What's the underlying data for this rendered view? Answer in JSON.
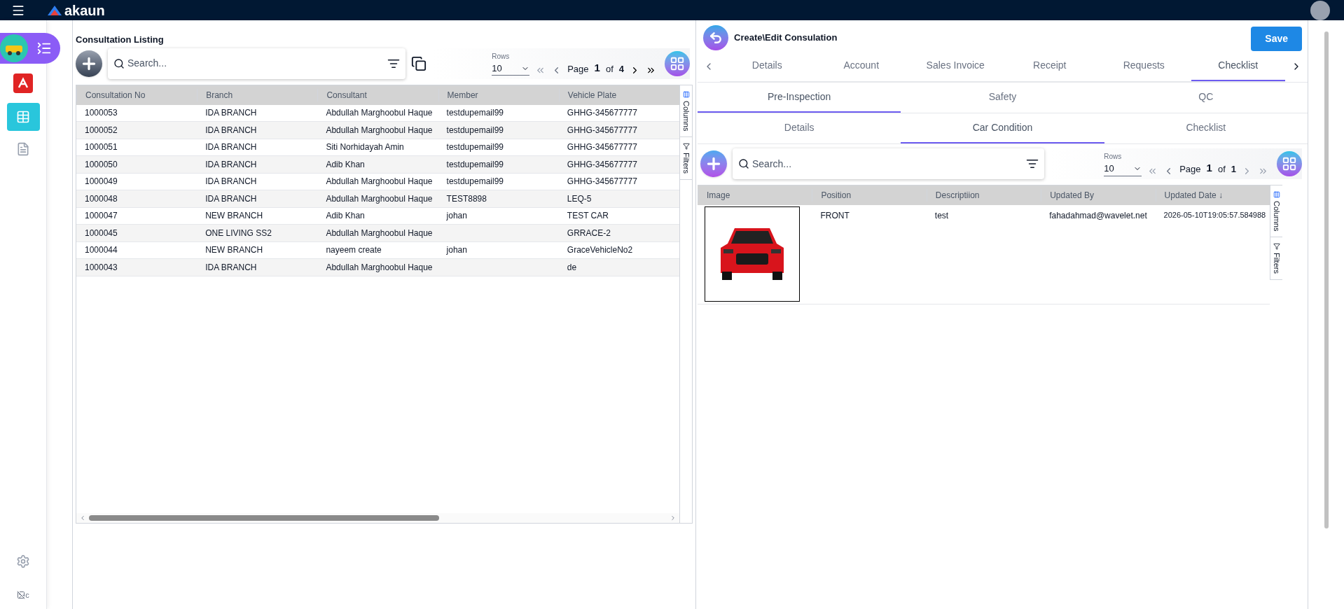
{
  "header": {
    "logo": "akaun"
  },
  "sidebar": {
    "items": [
      {
        "kind": "app",
        "selected": false
      },
      {
        "kind": "pdf",
        "selected": false
      },
      {
        "kind": "table",
        "selected": true
      },
      {
        "kind": "invoice",
        "selected": false
      }
    ],
    "broken_image_alt": "c"
  },
  "listing": {
    "title": "Consultation Listing",
    "search": {
      "placeholder": "Search..."
    },
    "pager": {
      "rows_label": "Rows",
      "rows": "10",
      "page_word": "Page",
      "page": "1",
      "of_word": "of",
      "total": "4"
    },
    "columns": [
      "Consultation No",
      "Branch",
      "Consultant",
      "Member",
      "Vehicle Plate"
    ],
    "rows": [
      [
        "1000053",
        "IDA BRANCH",
        "Abdullah Marghoobul Haque",
        "testdupemail99",
        "GHHG-345677777"
      ],
      [
        "1000052",
        "IDA BRANCH",
        "Abdullah Marghoobul Haque",
        "testdupemail99",
        "GHHG-345677777"
      ],
      [
        "1000051",
        "IDA BRANCH",
        "Siti Norhidayah Amin",
        "testdupemail99",
        "GHHG-345677777"
      ],
      [
        "1000050",
        "IDA BRANCH",
        "Adib Khan",
        "testdupemail99",
        "GHHG-345677777"
      ],
      [
        "1000049",
        "IDA BRANCH",
        "Abdullah Marghoobul Haque",
        "testdupemail99",
        "GHHG-345677777"
      ],
      [
        "1000048",
        "IDA BRANCH",
        "Abdullah Marghoobul Haque",
        "TEST8898",
        "LEQ-5"
      ],
      [
        "1000047",
        "NEW BRANCH",
        "Adib Khan",
        "johan",
        "TEST CAR"
      ],
      [
        "1000045",
        "ONE LIVING SS2",
        "Abdullah Marghoobul Haque",
        "",
        "GRRACE-2"
      ],
      [
        "1000044",
        "NEW BRANCH",
        "nayeem create",
        "johan",
        "GraceVehicleNo2"
      ],
      [
        "1000043",
        "IDA BRANCH",
        "Abdullah Marghoobul Haque",
        "",
        "de"
      ]
    ],
    "side_tabs": [
      "Columns",
      "Filters"
    ]
  },
  "editor": {
    "title": "Create\\Edit Consulation",
    "save": "Save",
    "tabs": [
      {
        "label": "Details",
        "selected": false
      },
      {
        "label": "Account",
        "selected": false
      },
      {
        "label": "Sales Invoice",
        "selected": false
      },
      {
        "label": "Receipt",
        "selected": false
      },
      {
        "label": "Requests",
        "selected": false
      },
      {
        "label": "Checklist",
        "selected": true
      }
    ],
    "sub_tabs": [
      {
        "label": "Pre-Inspection",
        "selected": true
      },
      {
        "label": "Safety",
        "selected": false
      },
      {
        "label": "QC",
        "selected": false
      }
    ],
    "section_tabs": [
      {
        "label": "Details",
        "selected": false
      },
      {
        "label": "Car Condition",
        "selected": true
      },
      {
        "label": "Checklist",
        "selected": false
      }
    ],
    "search": {
      "placeholder": "Search..."
    },
    "pager": {
      "rows_label": "Rows",
      "rows": "10",
      "page_word": "Page",
      "page": "1",
      "of_word": "of",
      "total": "1"
    },
    "columns": [
      "Image",
      "Position",
      "Descriptiion",
      "Updated By",
      "Updated Date ↓"
    ],
    "rows": [
      {
        "position": "FRONT",
        "description": "test",
        "updated_by": "fahadahmad@wavelet.net",
        "updated_date": "2026-05-10T19:05:57.584988"
      }
    ],
    "side_tabs": [
      "Columns",
      "Filters"
    ]
  }
}
